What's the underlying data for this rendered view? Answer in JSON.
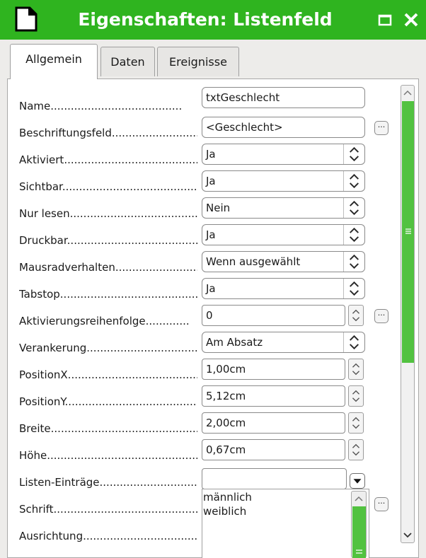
{
  "window": {
    "title": "Eigenschaften: Listenfeld",
    "icons": {
      "app": "document-icon",
      "maximize": "maximize-icon",
      "close": "close-icon"
    },
    "colors": {
      "titlebar": "#2fb41f",
      "accent": "#52c240",
      "dialog_bg": "#edecea"
    }
  },
  "tabs": [
    {
      "label": "Allgemein",
      "active": true
    },
    {
      "label": "Daten",
      "active": false
    },
    {
      "label": "Ereignisse",
      "active": false
    }
  ],
  "properties": [
    {
      "label": "Name.......................................",
      "value": "txtGeschlecht",
      "control": "text"
    },
    {
      "label": "Beschriftungsfeld...............................",
      "value": "<Geschlecht>",
      "control": "text",
      "extra_button": "..."
    },
    {
      "label": "Aktiviert..........................................",
      "value": "Ja",
      "control": "combo"
    },
    {
      "label": "Sichtbar...........................................",
      "value": "Ja",
      "control": "combo"
    },
    {
      "label": "Nur lesen..........................................",
      "value": "Nein",
      "control": "combo"
    },
    {
      "label": "Druckbar...........................................",
      "value": "Ja",
      "control": "combo"
    },
    {
      "label": "Mausradverhalten...............................",
      "value": "Wenn ausgewählt",
      "control": "combo"
    },
    {
      "label": "Tabstop............................................",
      "value": "Ja",
      "control": "combo"
    },
    {
      "label": "Aktivierungsreihenfolge.............",
      "value": "0",
      "control": "spin",
      "extra_button": "..."
    },
    {
      "label": "Verankerung.......................................",
      "value": "Am Absatz",
      "control": "combo"
    },
    {
      "label": "PositionX...........................................",
      "value": "1,00cm",
      "control": "spin"
    },
    {
      "label": "PositionY...........................................",
      "value": "5,12cm",
      "control": "spin"
    },
    {
      "label": "Breite...............................................",
      "value": "2,00cm",
      "control": "spin"
    },
    {
      "label": "Höhe.................................................",
      "value": "0,67cm",
      "control": "spin"
    },
    {
      "label": "Listen-Einträge...................................",
      "value": "",
      "control": "dropdown"
    },
    {
      "label": "Schrift..............................................",
      "control": "button",
      "extra_button": "..."
    },
    {
      "label": "Ausrichtung......................................."
    }
  ],
  "list_entries": [
    "männlich",
    "weiblich"
  ]
}
